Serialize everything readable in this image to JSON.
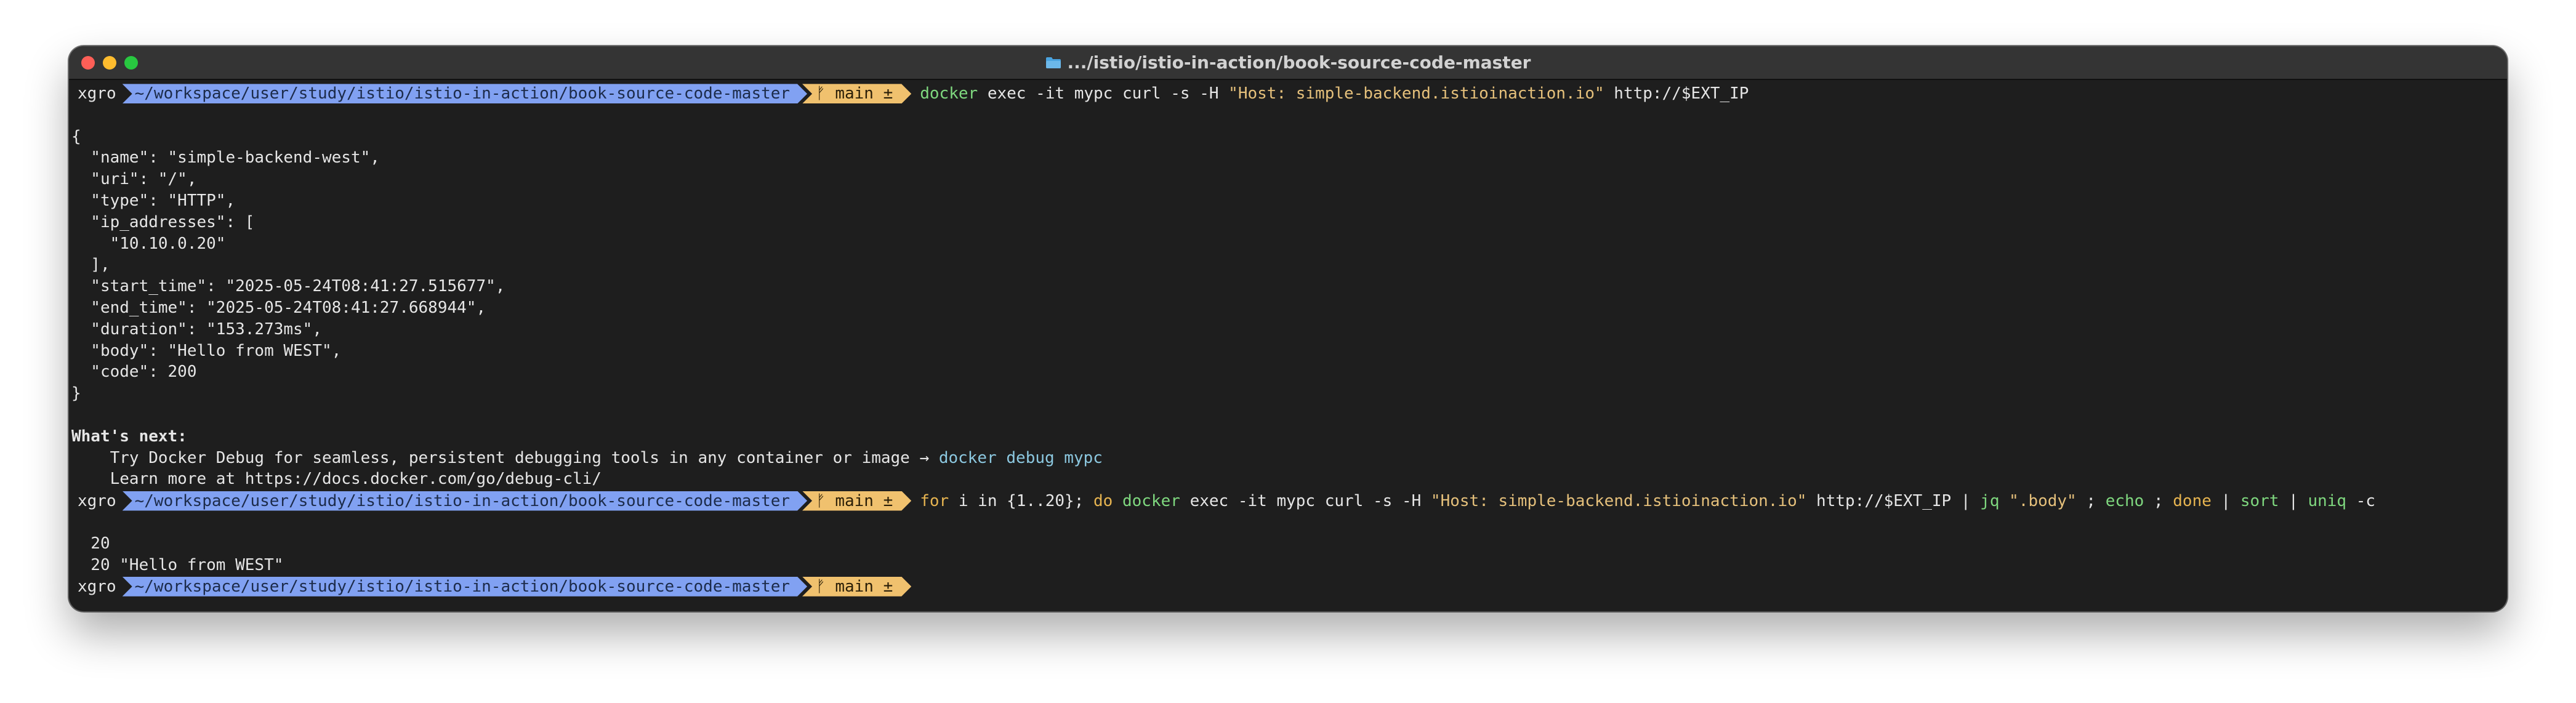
{
  "window": {
    "title": ".../istio/istio-in-action/book-source-code-master"
  },
  "prompt": {
    "user": "xgro",
    "path": "~/workspace/user/study/istio/istio-in-action/book-source-code-master",
    "branch": "ᚠ main ±"
  },
  "command1": {
    "docker": "docker",
    "args": " exec -it mypc curl -s -H ",
    "header": "\"Host: simple-backend.istioinaction.io\"",
    "url": " http://$EXT_IP"
  },
  "output": [
    "",
    "{",
    "  \"name\": \"simple-backend-west\",",
    "  \"uri\": \"/\",",
    "  \"type\": \"HTTP\",",
    "  \"ip_addresses\": [",
    "    \"10.10.0.20\"",
    "  ],",
    "  \"start_time\": \"2025-05-24T08:41:27.515677\",",
    "  \"end_time\": \"2025-05-24T08:41:27.668944\",",
    "  \"duration\": \"153.273ms\",",
    "  \"body\": \"Hello from WEST\",",
    "  \"code\": 200",
    "}",
    ""
  ],
  "whats_next": {
    "heading": "What's next:",
    "line1_text": "    Try Docker Debug for seamless, persistent debugging tools in any container or image → ",
    "line1_cmd": "docker debug mypc",
    "line2_text": "    Learn more at https://docs.docker.com/go/debug-cli/"
  },
  "command2": {
    "for": "for",
    "part1": " i in {1..20}; ",
    "do": "do",
    "space1": " ",
    "docker": "docker",
    "args": " exec -it mypc curl -s -H ",
    "header": "\"Host: simple-backend.istioinaction.io\"",
    "url": " http://$EXT_IP | ",
    "jq": "jq",
    "space2": " ",
    "filter": "\".body\"",
    "sep1": " ; ",
    "echo": "echo",
    "sep2": " ; ",
    "done": "done",
    "pipe1": " | ",
    "sort": "sort",
    "pipe2": " | ",
    "uniq": "uniq",
    "flag": " -c"
  },
  "output2": [
    "",
    "  20",
    "  20 \"Hello from WEST\""
  ]
}
